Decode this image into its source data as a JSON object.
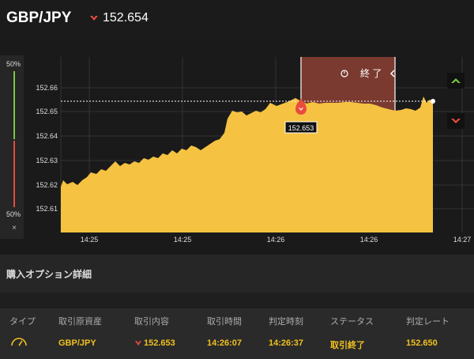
{
  "header": {
    "pair": "GBP/JPY",
    "price": "152.654"
  },
  "sidebar": {
    "top_pct": "50%",
    "bottom_pct": "50%",
    "close": "×"
  },
  "chart": {
    "y_ticks": [
      "152.66",
      "152.65",
      "152.64",
      "152.63",
      "152.62",
      "152.61"
    ],
    "x_ticks": [
      "14:25",
      "14:25",
      "14:26",
      "14:26",
      "14:27"
    ],
    "end_label": "終 了",
    "marker_price": "152.653",
    "current_price_level": 152.654
  },
  "section": {
    "title": "購入オプション詳細"
  },
  "table": {
    "headers": [
      "タイプ",
      "取引原資産",
      "取引内容",
      "取引時間",
      "判定時刻",
      "ステータス",
      "判定レート"
    ],
    "row": [
      "GBP/JPY",
      "152.653",
      "14:26:07",
      "14:26:37",
      "取引終了",
      "152.650"
    ]
  },
  "colors": {
    "accent": "#f5c242",
    "up": "#7ac943",
    "down": "#e84c3d",
    "expiry_zone": "#7a3a2f"
  }
}
